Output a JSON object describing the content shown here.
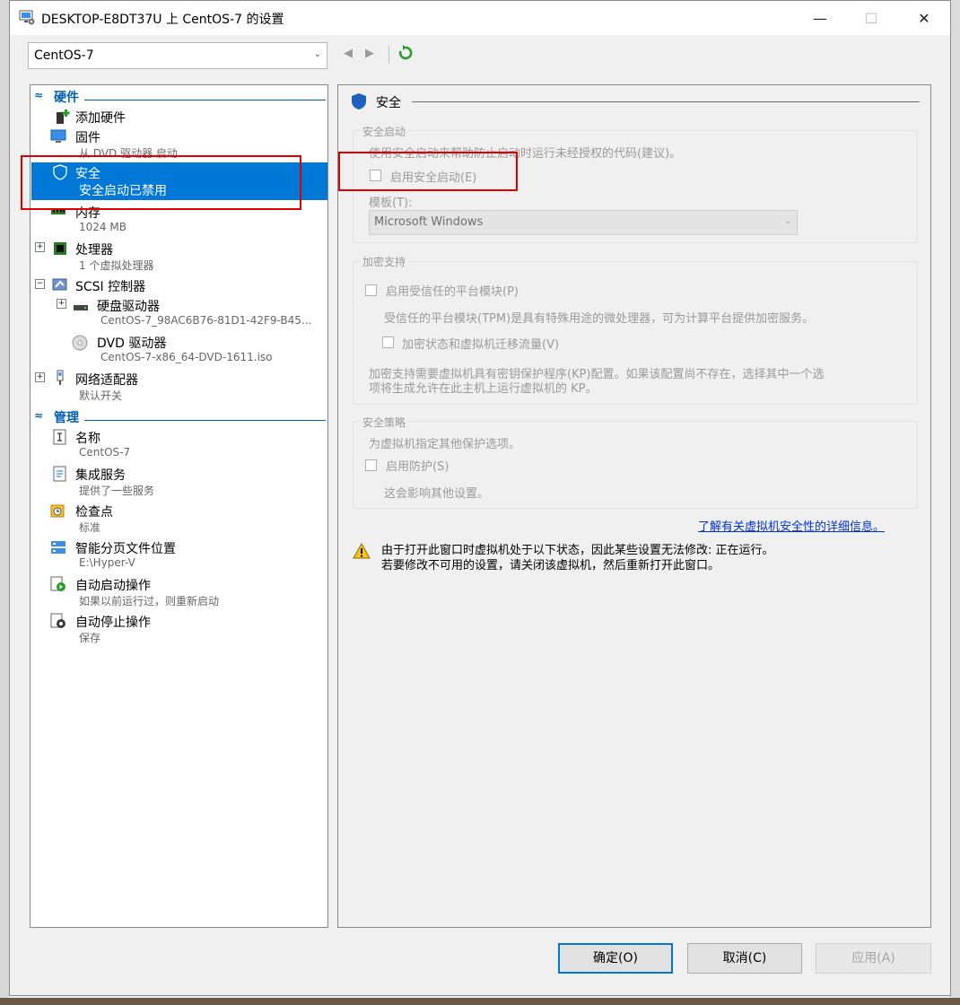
{
  "window": {
    "title": "DESKTOP-E8DT37U 上 CentOS-7 的设置",
    "minimize": "—",
    "maximize": "☐",
    "close": "✕"
  },
  "vm_selector": {
    "value": "CentOS-7"
  },
  "nav": {
    "back": "◀",
    "forward": "▶"
  },
  "tree": {
    "hardware_header": "硬件",
    "management_header": "管理",
    "hardware": [
      {
        "label": "添加硬件",
        "sub": "",
        "icon": "add-hardware-icon"
      },
      {
        "label": "固件",
        "sub": "从 DVD 驱动器 启动",
        "icon": "firmware-icon"
      },
      {
        "label": "安全",
        "sub": "安全启动已禁用",
        "icon": "shield-icon"
      },
      {
        "label": "内存",
        "sub": "1024 MB",
        "icon": "memory-icon"
      },
      {
        "label": "处理器",
        "sub": "1 个虚拟处理器",
        "icon": "processor-icon"
      },
      {
        "label": "SCSI 控制器",
        "sub": "",
        "icon": "scsi-controller-icon"
      },
      {
        "label": "硬盘驱动器",
        "sub": "CentOS-7_98AC6B76-81D1-42F9-B45...",
        "icon": "hard-drive-icon"
      },
      {
        "label": "DVD 驱动器",
        "sub": "CentOS-7-x86_64-DVD-1611.iso",
        "icon": "dvd-drive-icon"
      },
      {
        "label": "网络适配器",
        "sub": "默认开关",
        "icon": "network-adapter-icon"
      }
    ],
    "management": [
      {
        "label": "名称",
        "sub": "CentOS-7",
        "icon": "name-icon"
      },
      {
        "label": "集成服务",
        "sub": "提供了一些服务",
        "icon": "integration-services-icon"
      },
      {
        "label": "检查点",
        "sub": "标准",
        "icon": "checkpoint-icon"
      },
      {
        "label": "智能分页文件位置",
        "sub": "E:\\Hyper-V",
        "icon": "smart-paging-icon"
      },
      {
        "label": "自动启动操作",
        "sub": "如果以前运行过，则重新启动",
        "icon": "auto-start-icon"
      },
      {
        "label": "自动停止操作",
        "sub": "保存",
        "icon": "auto-stop-icon"
      }
    ]
  },
  "panel": {
    "title": "安全",
    "secure_boot": {
      "legend": "安全启动",
      "desc": "使用安全启动来帮助防止启动时运行未经授权的代码(建议)。",
      "checkbox": "启用安全启动(E)",
      "template_label": "模板(T):",
      "template_value": "Microsoft Windows"
    },
    "encryption": {
      "legend": "加密支持",
      "tpm_checkbox": "启用受信任的平台模块(P)",
      "tpm_desc": "受信任的平台模块(TPM)是具有特殊用途的微处理器，可为计算平台提供加密服务。",
      "encrypt_checkbox": "加密状态和虚拟机迁移流量(V)",
      "note_line1": "加密支持需要虚拟机具有密钥保护程序(KP)配置。如果该配置尚不存在，选择其中一个选",
      "note_line2": "项将生成允许在此主机上运行虚拟机的 KP。"
    },
    "policy": {
      "legend": "安全策略",
      "desc": "为虚拟机指定其他保护选项。",
      "checkbox": "启用防护(S)",
      "note": "这会影响其他设置。"
    },
    "link": "了解有关虚拟机安全性的详细信息。",
    "warning_line1": "由于打开此窗口时虚拟机处于以下状态，因此某些设置无法修改: 正在运行。",
    "warning_line2": "若要修改不可用的设置，请关闭该虚拟机，然后重新打开此窗口。"
  },
  "buttons": {
    "ok": "确定(O)",
    "cancel": "取消(C)",
    "apply": "应用(A)"
  },
  "colors": {
    "selection": "#0078d7",
    "highlight_box": "#e00000",
    "link": "#0033cc"
  }
}
